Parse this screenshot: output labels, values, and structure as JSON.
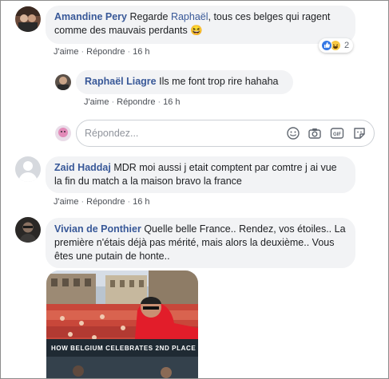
{
  "comments": [
    {
      "author": "Amandine Pery",
      "text_before": "Regarde ",
      "mention": "Raphaël",
      "text_after": ", tous ces belges qui ragent comme des mauvais perdants 😆",
      "actions": {
        "like": "J'aime",
        "reply": "Répondre",
        "time": "16 h"
      },
      "reaction_count": "2"
    },
    {
      "author": "Raphaël Liagre",
      "text": "Ils me font trop rire hahaha",
      "actions": {
        "like": "J'aime",
        "reply": "Répondre",
        "time": "16 h"
      }
    },
    {
      "author": "Zaid Haddaj",
      "text": "MDR moi aussi j etait comptent par comtre j ai vue la fin du match a la maison bravo la france",
      "actions": {
        "like": "J'aime",
        "reply": "Répondre",
        "time": "16 h"
      }
    },
    {
      "author": "Vivian de Ponthier",
      "text": "Quelle belle France.. Rendez, vos étoiles.. La première n'étais déjà pas mérité, mais alors la deuxième.. Vous êtes une putain de honte.."
    }
  ],
  "reply_input": {
    "placeholder": "Répondez..."
  },
  "photo": {
    "caption": "HOW BELGIUM CELEBRATES 2ND PLACE"
  },
  "separator": "·",
  "colors": {
    "link": "#385898",
    "bubble": "#f2f3f5",
    "meta": "#606770"
  },
  "icons": [
    "like-reaction-icon",
    "haha-reaction-icon",
    "emoji-icon",
    "camera-icon",
    "gif-icon",
    "sticker-icon"
  ]
}
